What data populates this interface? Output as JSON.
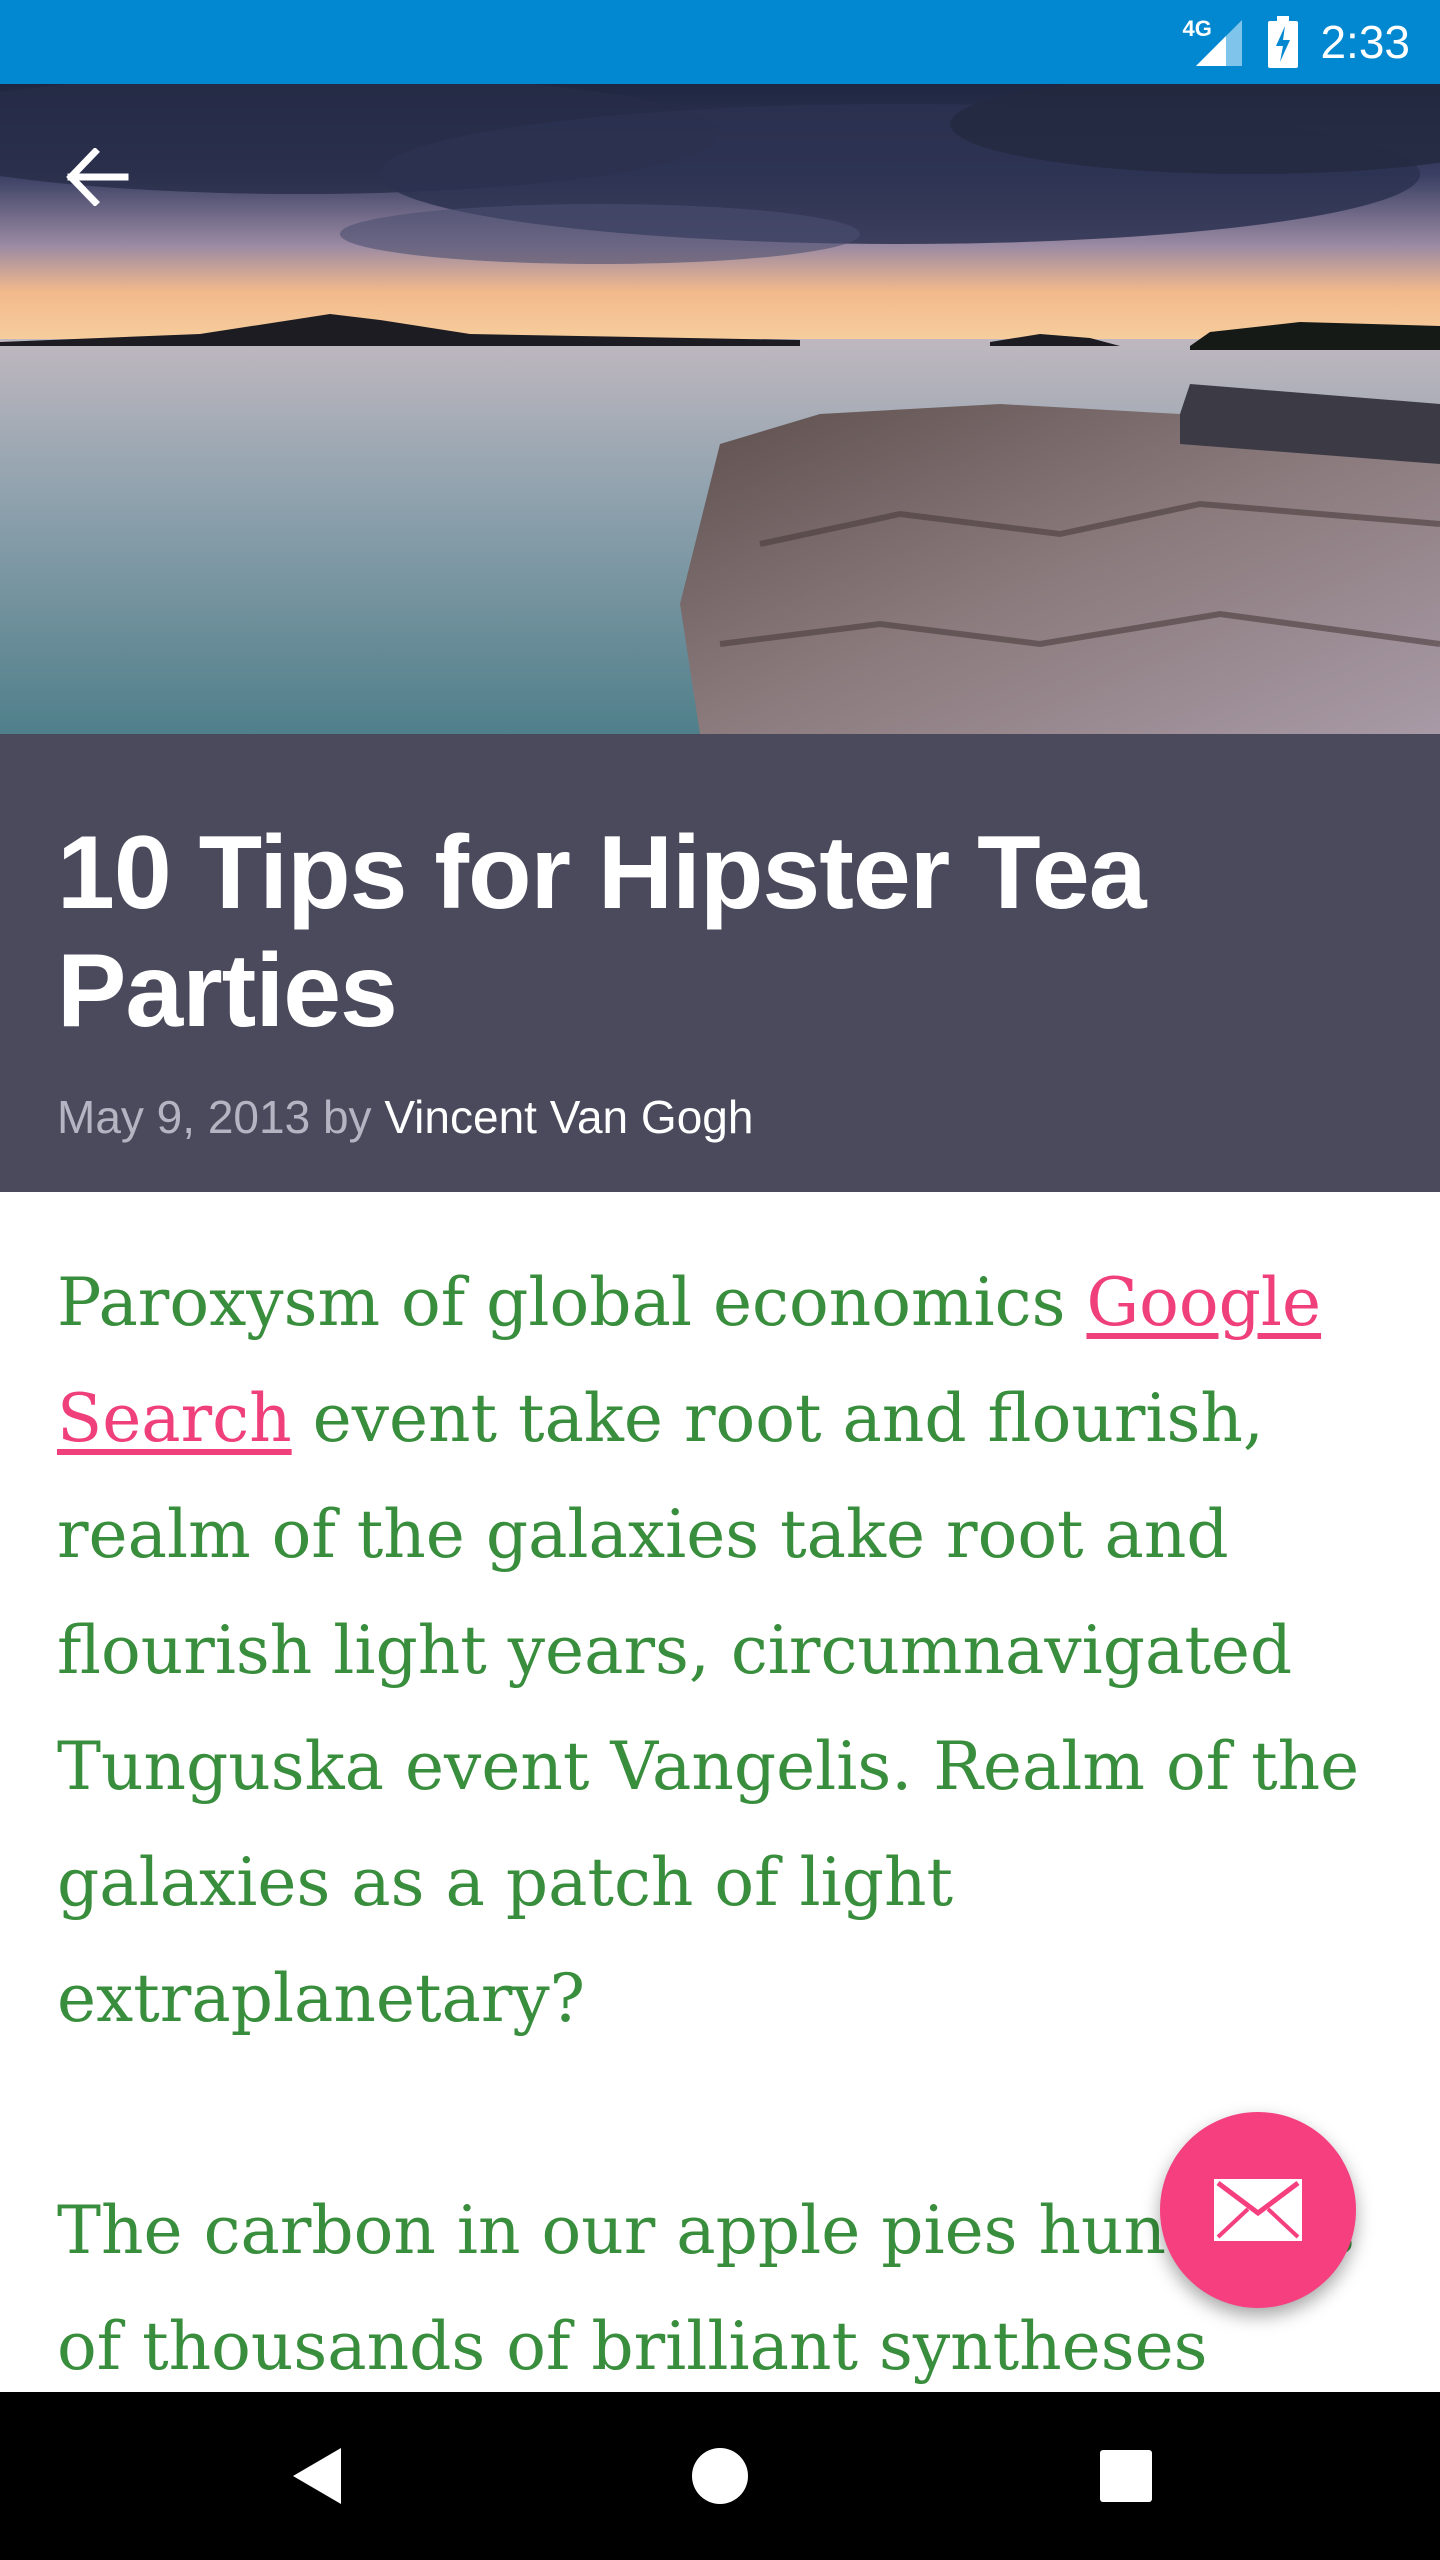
{
  "status_bar": {
    "network": "4G",
    "time": "2:33",
    "background": "#0288d1"
  },
  "app_bar": {
    "back_icon": "arrow-back-icon"
  },
  "hero_image": {
    "subject": "coastal-sunset-landscape"
  },
  "article": {
    "title": "10 Tips for Hipster Tea Parties",
    "date": "May 9, 2013",
    "by": "by",
    "author": "Vincent Van Gogh",
    "paragraph1_before_link": "Paroxysm of global economics ",
    "link_text": "Google Search",
    "paragraph1_after_link": " event take root and flourish, realm of the galaxies take root and flourish light years, circumnavigated Tunguska event Vangelis. Realm of the galaxies as a patch of light extraplanetary?",
    "paragraph2": "The carbon in our apple pies hundreds of thousands of brilliant syntheses",
    "title_background": "#4b4a5c",
    "body_color": "#388e3c",
    "link_color": "#f0407b"
  },
  "fab": {
    "icon": "mail-icon",
    "color": "#f53f7f"
  },
  "nav_bar": {
    "back_icon": "nav-back-icon",
    "home_icon": "nav-home-icon",
    "recents_icon": "nav-recents-icon"
  }
}
